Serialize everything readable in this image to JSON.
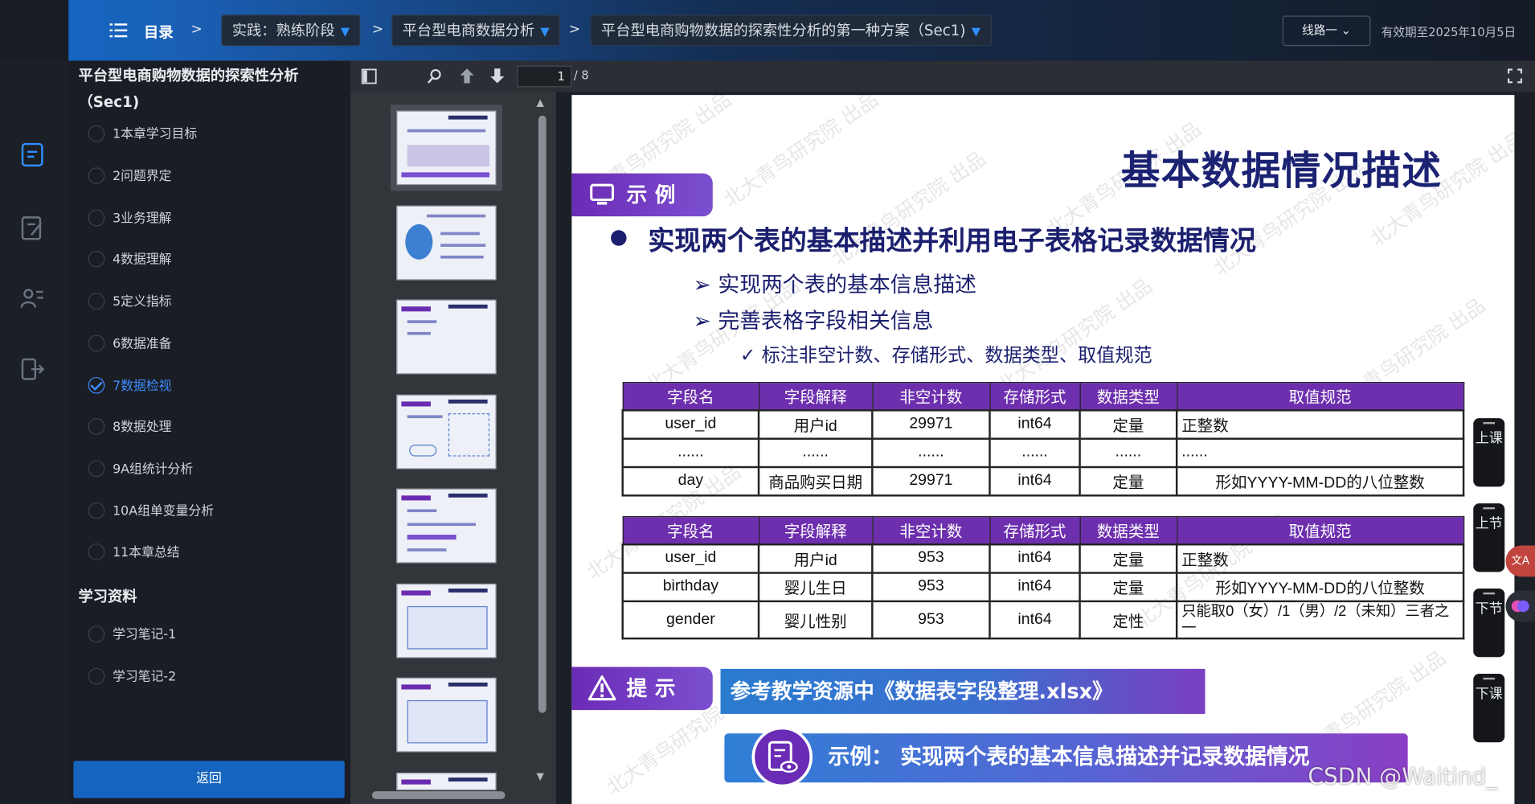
{
  "topbar": {
    "menu_label": "目录",
    "crumb_sep": ">",
    "crumbs": [
      {
        "label": "实践：熟练阶段"
      },
      {
        "label": "平台型电商数据分析"
      },
      {
        "label": "平台型电商购物数据的探索性分析的第一种方案（Sec1)"
      }
    ],
    "dropdown_glyph": "▼",
    "route_label": "线路一",
    "expiry_text": "有效期至2025年10月5日"
  },
  "sidebar": {
    "course_title": "平台型电商购物数据的探索性分析（Sec1)",
    "chapters": [
      {
        "label": "1本章学习目标",
        "active": false
      },
      {
        "label": "2问题界定",
        "active": false
      },
      {
        "label": "3业务理解",
        "active": false
      },
      {
        "label": "4数据理解",
        "active": false
      },
      {
        "label": "5定义指标",
        "active": false
      },
      {
        "label": "6数据准备",
        "active": false
      },
      {
        "label": "7数据检视",
        "active": true
      },
      {
        "label": "8数据处理",
        "active": false
      },
      {
        "label": "9A组统计分析",
        "active": false
      },
      {
        "label": "10A组单变量分析",
        "active": false
      },
      {
        "label": "11本章总结",
        "active": false
      }
    ],
    "resources_heading": "学习资料",
    "resources": [
      {
        "label": "学习笔记-1"
      },
      {
        "label": "学习笔记-2"
      }
    ],
    "back_label": "返回"
  },
  "viewer": {
    "current_page": "1",
    "page_total": "/ 8"
  },
  "slide": {
    "title": "基本数据情况描述",
    "example_tag": "示例",
    "main_bullet": "实现两个表的基本描述并利用电子表格记录数据情况",
    "sub1": "➢ 实现两个表的基本信息描述",
    "sub2": "➢ 完善表格字段相关信息",
    "subsub": "✓ 标注非空计数、存储形式、数据类型、取值规范",
    "table_headers": [
      "字段名",
      "字段解释",
      "非空计数",
      "存储形式",
      "数据类型",
      "取值规范"
    ],
    "table1_rows": [
      [
        "user_id",
        "用户id",
        "29971",
        "int64",
        "定量",
        "正整数"
      ],
      [
        "......",
        "......",
        "......",
        "......",
        "......",
        "......"
      ],
      [
        "day",
        "商品购买日期",
        "29971",
        "int64",
        "定量",
        "形如YYYY-MM-DD的八位整数"
      ]
    ],
    "table2_rows": [
      [
        "user_id",
        "用户id",
        "953",
        "int64",
        "定量",
        "正整数"
      ],
      [
        "birthday",
        "婴儿生日",
        "953",
        "int64",
        "定量",
        "形如YYYY-MM-DD的八位整数"
      ],
      [
        "gender",
        "婴儿性别",
        "953",
        "int64",
        "定性",
        "只能取0（女）/1（男）/2（未知）三者之一"
      ]
    ],
    "tip_tag": "提示",
    "tip_text": "参考教学资源中《数据表字段整理.xlsx》",
    "banner_text": "示例：  实现两个表的基本信息描述并记录数据情况",
    "watermark": "北大青鸟研究院 出品"
  },
  "right_nav": [
    {
      "label": "上课"
    },
    {
      "label": "上节"
    },
    {
      "label": "下节"
    },
    {
      "label": "下课"
    }
  ],
  "fab_translate": "文A",
  "csdn_mark": "CSDN @Waitind_",
  "colors": {
    "accent_blue": "#1565c0",
    "slide_purple": "#6d2fae",
    "slide_navy": "#1b2272"
  }
}
